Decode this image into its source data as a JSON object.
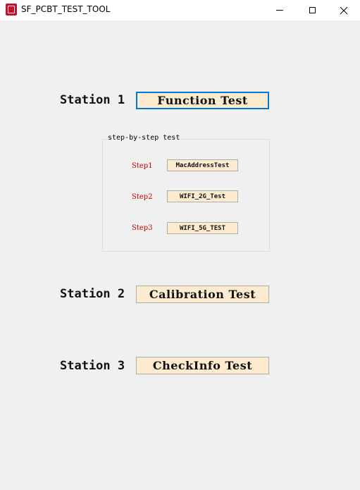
{
  "window": {
    "title": "SF_PCBT_TEST_TOOL",
    "icon": "app-logo-icon",
    "controls": {
      "minimize": "minimize-icon",
      "maximize": "maximize-icon",
      "close": "close-icon"
    }
  },
  "stations": [
    {
      "label": "Station 1",
      "button": "Function Test"
    },
    {
      "label": "Station 2",
      "button": "Calibration Test"
    },
    {
      "label": "Station 3",
      "button": "CheckInfo Test"
    }
  ],
  "step_group": {
    "title": "step-by-step test",
    "steps": [
      {
        "label": "Step1",
        "button": "MacAddressTest"
      },
      {
        "label": "Step2",
        "button": "WIFI_2G_Test"
      },
      {
        "label": "Step3",
        "button": "WIFI_5G_TEST"
      }
    ]
  },
  "colors": {
    "button_fill": "#fdebd0",
    "focus_border": "#0078d7",
    "step_label": "#c00000",
    "background": "#f0f0f0"
  }
}
